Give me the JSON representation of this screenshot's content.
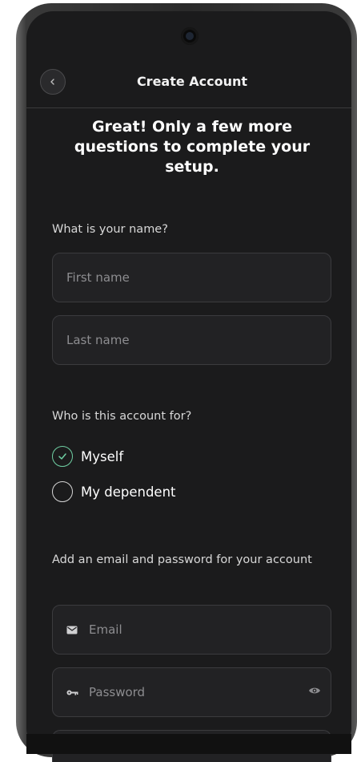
{
  "header": {
    "title": "Create Account",
    "back_icon": "chevron-left-icon"
  },
  "headline": "Great! Only a few more questions to complete your setup.",
  "name_section": {
    "label": "What is your name?",
    "first_name_placeholder": "First name",
    "last_name_placeholder": "Last name"
  },
  "account_for": {
    "label": "Who is this account for?",
    "options": [
      {
        "label": "Myself",
        "selected": true
      },
      {
        "label": "My dependent",
        "selected": false
      }
    ]
  },
  "credentials": {
    "label": "Add an email and password for your account",
    "email_placeholder": "Email",
    "email_icon": "envelope-icon",
    "password_placeholder": "Password",
    "password_icon": "key-icon",
    "password_toggle_icon": "eye-icon"
  },
  "colors": {
    "background": "#1b1b1c",
    "accent": "#6fcfa3",
    "field_bg": "#222224"
  }
}
